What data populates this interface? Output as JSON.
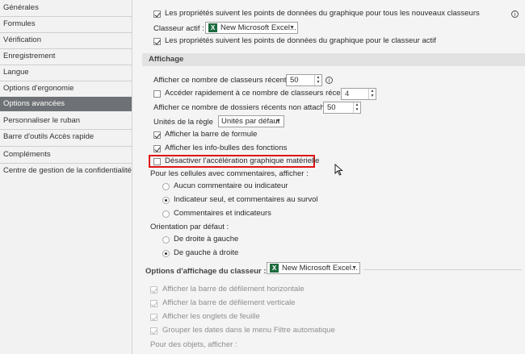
{
  "sidebar": {
    "items": [
      {
        "label": "Générales"
      },
      {
        "label": "Formules"
      },
      {
        "label": "Vérification"
      },
      {
        "label": "Enregistrement"
      },
      {
        "label": "Langue"
      },
      {
        "label": "Options d'ergonomie"
      },
      {
        "label": "Options avancées"
      },
      {
        "label": "Personnaliser le ruban"
      },
      {
        "label": "Barre d'outils Accès rapide"
      },
      {
        "label": "Compléments"
      },
      {
        "label": "Centre de gestion de la confidentialité"
      }
    ]
  },
  "top": {
    "datapoints_all": "Les propriétés suivent les points de données du graphique pour tous les nouveaux classeurs",
    "active_workbook_label": "Classeur actif :",
    "active_workbook_value": "New Microsoft Excel...",
    "datapoints_active": "Les propriétés suivent les points de données du graphique pour le classeur actif"
  },
  "display": {
    "title": "Affichage",
    "recent_count_label": "Afficher ce nombre de classeurs récents :",
    "recent_count_value": "50",
    "quick_access_label": "Accéder rapidement à ce nombre de classeurs récents :",
    "quick_access_value": "4",
    "recent_folders_label": "Afficher ce nombre de dossiers récents non attachés :",
    "recent_folders_value": "50",
    "ruler_units_label": "Unités de la règle",
    "ruler_units_value": "Unités par défaut",
    "formula_bar": "Afficher la barre de formule",
    "function_tooltips": "Afficher les info-bulles des fonctions",
    "disable_hw_accel": "Désactiver l'accélération graphique matérielle",
    "comments_label": "Pour les cellules avec commentaires, afficher :",
    "comments_none": "Aucun commentaire ou indicateur",
    "comments_indicator": "Indicateur seul, et commentaires au survol",
    "comments_both": "Commentaires et indicateurs",
    "orientation_label": "Orientation par défaut :",
    "orientation_rtl": "De droite à gauche",
    "orientation_ltr": "De gauche à droite"
  },
  "workbook_display": {
    "title": "Options d'affichage du classeur :",
    "workbook_value": "New Microsoft Excel...",
    "hscroll": "Afficher la barre de défilement horizontale",
    "vscroll": "Afficher la barre de défilement verticale",
    "sheet_tabs": "Afficher les onglets de feuille",
    "group_dates": "Grouper les dates dans le menu Filtre automatique",
    "objects_label": "Pour des objets, afficher :"
  },
  "icons": {
    "excel": "X",
    "info": "i",
    "dropdown": "▼",
    "spin_up": "▲",
    "spin_down": "▼"
  },
  "colors": {
    "active_nav": "#6e7175",
    "highlight": "#e01414",
    "excel_green": "#1d6b3f"
  }
}
